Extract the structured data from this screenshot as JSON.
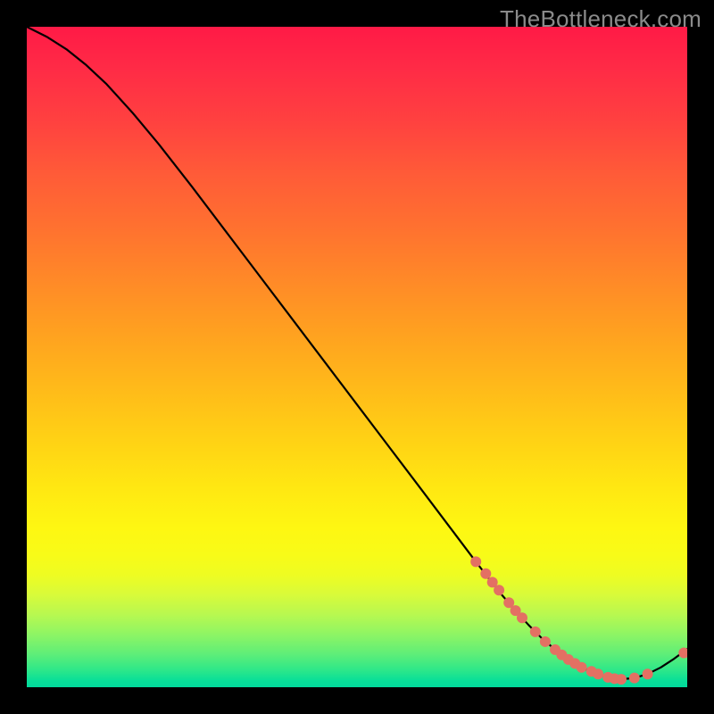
{
  "watermark": "TheBottleneck.com",
  "chart_data": {
    "type": "line",
    "title": "",
    "xlabel": "",
    "ylabel": "",
    "xlim": [
      0,
      100
    ],
    "ylim": [
      0,
      100
    ],
    "grid": false,
    "legend": false,
    "series": [
      {
        "name": "bottleneck-curve",
        "x": [
          0,
          3,
          6,
          9,
          12,
          16,
          20,
          25,
          30,
          35,
          40,
          45,
          50,
          55,
          60,
          64,
          68,
          70,
          72,
          74,
          76,
          78,
          80,
          82,
          84,
          86,
          88,
          90,
          92,
          94,
          96,
          98,
          100
        ],
        "y": [
          100,
          98.5,
          96.6,
          94.2,
          91.4,
          87.0,
          82.2,
          75.8,
          69.2,
          62.6,
          56.0,
          49.4,
          42.8,
          36.2,
          29.6,
          24.3,
          19.0,
          16.4,
          13.9,
          11.6,
          9.4,
          7.4,
          5.7,
          4.2,
          3.0,
          2.1,
          1.5,
          1.2,
          1.4,
          2.0,
          3.0,
          4.3,
          5.8
        ]
      }
    ],
    "markers": {
      "name": "highlight-points",
      "color": "#e37063",
      "x": [
        68,
        69.5,
        70.5,
        71.5,
        73,
        74,
        75,
        77,
        78.5,
        80,
        81,
        82,
        83,
        84,
        85.5,
        86.5,
        88,
        89,
        90,
        92,
        94,
        99.5
      ],
      "y": [
        19.0,
        17.2,
        15.9,
        14.7,
        12.8,
        11.6,
        10.5,
        8.4,
        6.9,
        5.7,
        4.9,
        4.2,
        3.6,
        3.0,
        2.4,
        2.0,
        1.5,
        1.3,
        1.2,
        1.4,
        2.0,
        5.2
      ]
    },
    "background_gradient": {
      "orientation": "vertical",
      "stops": [
        {
          "pos": 0.0,
          "color": "#ff1a46"
        },
        {
          "pos": 0.5,
          "color": "#ffb81a"
        },
        {
          "pos": 0.78,
          "color": "#fef712"
        },
        {
          "pos": 0.92,
          "color": "#8ef564"
        },
        {
          "pos": 1.0,
          "color": "#02d99c"
        }
      ]
    }
  }
}
